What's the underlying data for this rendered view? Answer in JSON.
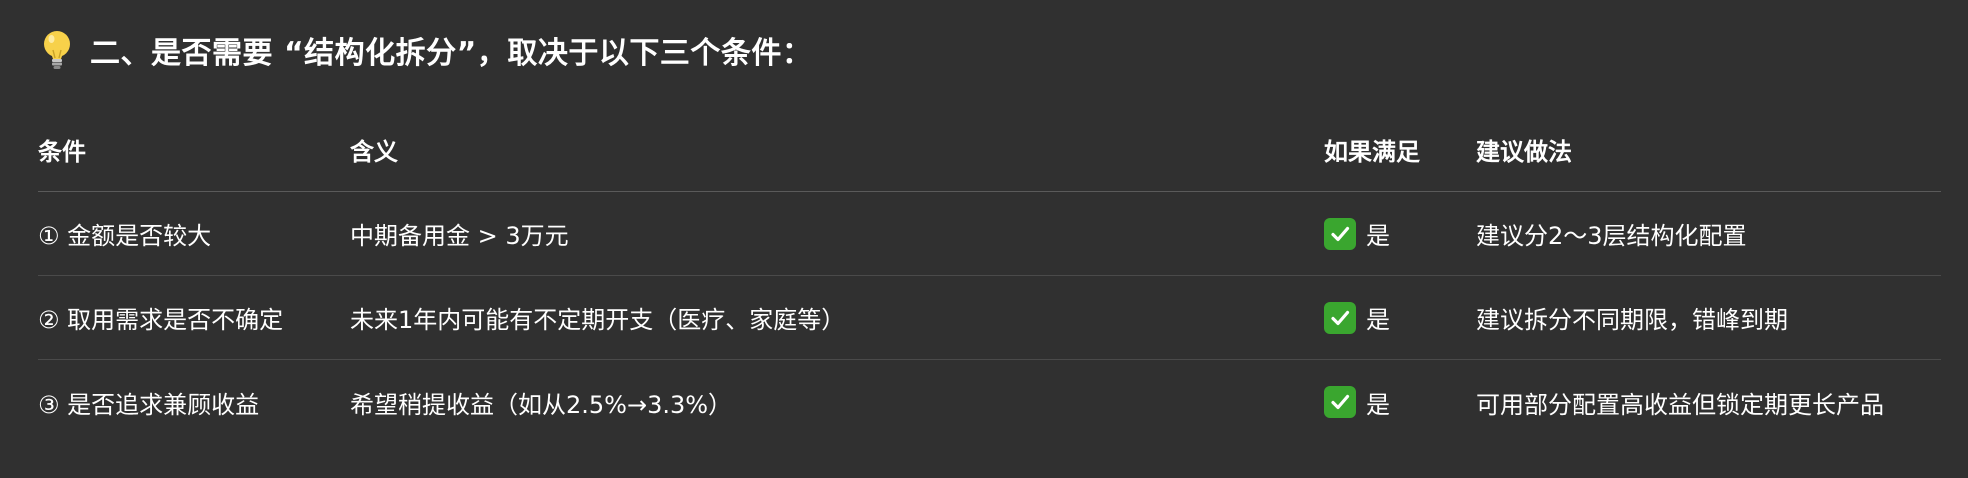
{
  "heading": {
    "icon": "lightbulb-icon",
    "text": "二、是否需要 “结构化拆分”，取决于以下三个条件："
  },
  "table": {
    "columns": [
      "条件",
      "含义",
      "如果满足",
      "建议做法"
    ],
    "rows": [
      {
        "condition": "① 金额是否较大",
        "meaning": "中期备用金 > 3万元",
        "satisfied": "是",
        "satisfied_icon": "check-mark-button-icon",
        "suggestion": "建议分2～3层结构化配置"
      },
      {
        "condition": "② 取用需求是否不确定",
        "meaning": "未来1年内可能有不定期开支（医疗、家庭等）",
        "satisfied": "是",
        "satisfied_icon": "check-mark-button-icon",
        "suggestion": "建议拆分不同期限，错峰到期"
      },
      {
        "condition": "③ 是否追求兼顾收益",
        "meaning": "希望稍提收益（如从2.5%→3.3%）",
        "satisfied": "是",
        "satisfied_icon": "check-mark-button-icon",
        "suggestion": "可用部分配置高收益但锁定期更长产品"
      }
    ]
  },
  "colors": {
    "background": "#303030",
    "text": "#ffffff",
    "check_green": "#3aa62f",
    "divider": "#4a4a4a"
  }
}
